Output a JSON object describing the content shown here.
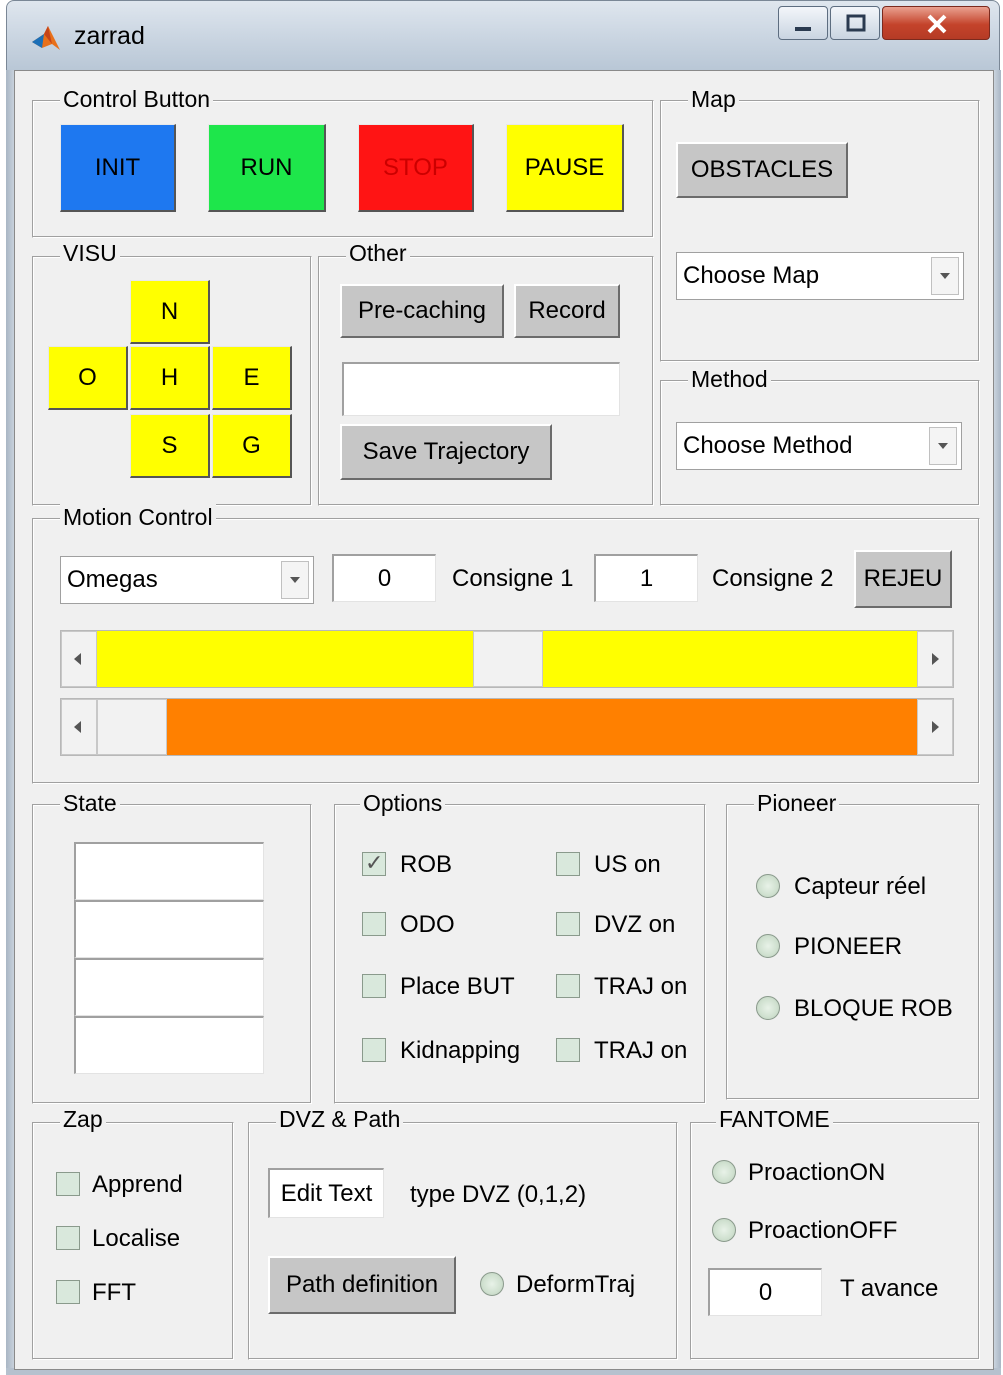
{
  "window": {
    "title": "zarrad"
  },
  "control": {
    "title": "Control Button",
    "buttons": [
      {
        "label": "INIT",
        "color": "#1e78f0"
      },
      {
        "label": "RUN",
        "color": "#1ee64b"
      },
      {
        "label": "STOP",
        "color": "#ff1414"
      },
      {
        "label": "PAUSE",
        "color": "#ffff00"
      }
    ]
  },
  "map": {
    "title": "Map",
    "obstacles_label": "OBSTACLES",
    "popup_value": "Choose Map"
  },
  "method": {
    "title": "Method",
    "popup_value": "Choose Method"
  },
  "visu": {
    "title": "VISU",
    "buttons": [
      "N",
      "O",
      "H",
      "E",
      "S",
      "G"
    ],
    "color": "#ffff00"
  },
  "other": {
    "title": "Other",
    "precaching_label": "Pre-caching",
    "record_label": "Record",
    "edit_value": "",
    "save_label": "Save Trajectory"
  },
  "motion": {
    "title": "Motion Control",
    "popup_value": "Omegas",
    "consigne1_value": "0",
    "consigne1_label": "Consigne 1",
    "consigne2_value": "1",
    "consigne2_label": "Consigne 2",
    "rejeu_label": "REJEU",
    "slider1": {
      "value_fraction": 0.5,
      "color": "#ffff00"
    },
    "slider2": {
      "value_fraction": 0.0,
      "color": "#ff8000"
    }
  },
  "state": {
    "title": "State",
    "fields": [
      "",
      "",
      "",
      ""
    ]
  },
  "options": {
    "title": "Options",
    "left": [
      {
        "label": "ROB",
        "checked": true
      },
      {
        "label": "ODO",
        "checked": false
      },
      {
        "label": "Place BUT",
        "checked": false
      },
      {
        "label": "Kidnapping",
        "checked": false
      }
    ],
    "right": [
      {
        "label": "US on",
        "checked": false
      },
      {
        "label": "DVZ on",
        "checked": false
      },
      {
        "label": "TRAJ on",
        "checked": false
      },
      {
        "label": "TRAJ on",
        "checked": false
      }
    ]
  },
  "pioneer": {
    "title": "Pioneer",
    "radios": [
      "Capteur réel",
      "PIONEER",
      "BLOQUE ROB"
    ]
  },
  "zap": {
    "title": "Zap",
    "checks": [
      "Apprend",
      "Localise",
      "FFT"
    ]
  },
  "dvz": {
    "title": "DVZ & Path",
    "edit_value": "Edit Text",
    "type_label": "type DVZ (0,1,2)",
    "path_label": "Path definition",
    "deform_label": "DeformTraj"
  },
  "fantome": {
    "title": "FANTOME",
    "radios": [
      "ProactionON",
      "ProactionOFF"
    ],
    "tavance_value": "0",
    "tavance_label": "T avance"
  }
}
